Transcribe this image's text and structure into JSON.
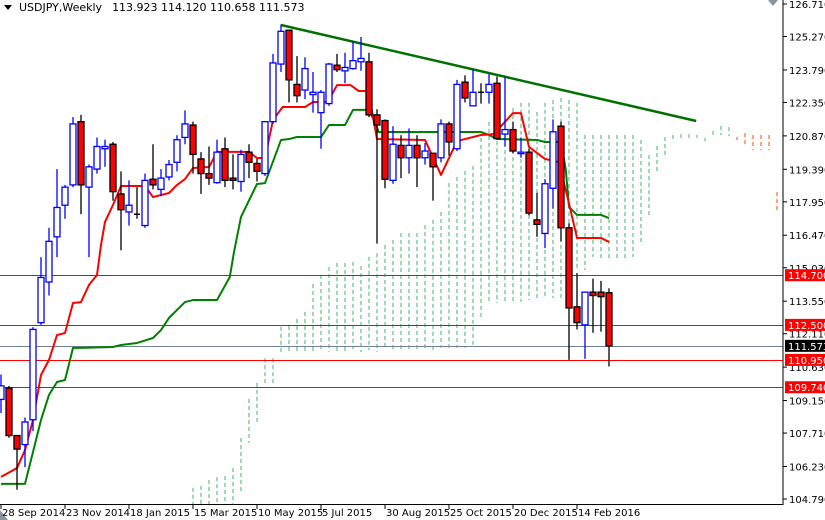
{
  "header": {
    "symbol": "USDJPY,Weekly",
    "ohlc": "113.923 114.120 110.658 111.573"
  },
  "colors": {
    "bull": "#0000ff",
    "bear": "#ff0000",
    "tenkan": "#ff0000",
    "kijun": "#008000",
    "trendline": "#007000",
    "cloud_bull": "#3cb371",
    "cloud_bear": "#ff4500",
    "level": "#ff0000",
    "current": "#708090"
  },
  "chart_data": {
    "type": "candlestick",
    "title": "USDJPY,Weekly",
    "ylim": [
      104.79,
      126.71
    ],
    "y_ticks": [
      "126.710",
      "125.270",
      "123.790",
      "122.350",
      "120.870",
      "119.390",
      "117.950",
      "116.470",
      "115.030",
      "113.550",
      "112.110",
      "110.630",
      "109.150",
      "107.710",
      "106.230",
      "104.790"
    ],
    "x_labels": [
      {
        "i": 0,
        "label": "28 Sep 2014"
      },
      {
        "i": 8,
        "label": "23 Nov 2014"
      },
      {
        "i": 16,
        "label": "18 Jan 2015"
      },
      {
        "i": 24,
        "label": "15 Mar 2015"
      },
      {
        "i": 32,
        "label": "10 May 2015"
      },
      {
        "i": 40,
        "label": "5 Jul 2015"
      },
      {
        "i": 48,
        "label": "30 Aug 2015"
      },
      {
        "i": 56,
        "label": "25 Oct 2015"
      },
      {
        "i": 64,
        "label": "20 Dec 2015"
      },
      {
        "i": 72,
        "label": "14 Feb 2016"
      }
    ],
    "candles_ohlc": [
      [
        109.2,
        110.3,
        108.6,
        109.8
      ],
      [
        109.7,
        109.8,
        107.5,
        107.6
      ],
      [
        107.6,
        107.6,
        105.2,
        107.0
      ],
      [
        107.2,
        108.4,
        106.2,
        108.2
      ],
      [
        108.3,
        112.4,
        107.8,
        112.3
      ],
      [
        112.6,
        115.5,
        112.5,
        114.6
      ],
      [
        114.4,
        116.8,
        113.8,
        116.2
      ],
      [
        116.4,
        119.4,
        115.5,
        117.7
      ],
      [
        117.8,
        118.7,
        117.2,
        118.6
      ],
      [
        118.7,
        121.7,
        118.6,
        121.4
      ],
      [
        121.5,
        121.8,
        117.4,
        118.7
      ],
      [
        118.6,
        119.6,
        115.5,
        119.5
      ],
      [
        119.4,
        120.8,
        119.2,
        120.4
      ],
      [
        120.3,
        120.7,
        119.5,
        120.4
      ],
      [
        120.5,
        120.6,
        118.0,
        118.4
      ],
      [
        118.3,
        119.3,
        115.8,
        117.6
      ],
      [
        117.5,
        118.9,
        116.9,
        117.8
      ],
      [
        117.4,
        118.6,
        117.2,
        117.4
      ],
      [
        116.9,
        119.2,
        116.8,
        118.9
      ],
      [
        118.95,
        120.5,
        118.5,
        118.7
      ],
      [
        118.5,
        119.4,
        118.2,
        119.0
      ],
      [
        119.05,
        119.8,
        118.9,
        119.6
      ],
      [
        119.7,
        120.9,
        119.3,
        120.7
      ],
      [
        120.8,
        122.0,
        120.5,
        121.4
      ],
      [
        121.35,
        121.5,
        119.2,
        120.05
      ],
      [
        119.85,
        120.15,
        118.3,
        119.2
      ],
      [
        119.2,
        120.4,
        118.7,
        119.0
      ],
      [
        118.8,
        120.7,
        118.75,
        120.15
      ],
      [
        120.3,
        120.8,
        118.6,
        118.9
      ],
      [
        119.0,
        120.05,
        118.5,
        118.9
      ],
      [
        118.85,
        120.25,
        118.4,
        120.05
      ],
      [
        120.15,
        120.5,
        119.0,
        119.7
      ],
      [
        119.65,
        119.85,
        118.85,
        119.3
      ],
      [
        119.2,
        121.5,
        119.1,
        121.5
      ],
      [
        121.5,
        124.5,
        121.4,
        124.1
      ],
      [
        124.05,
        125.8,
        123.7,
        125.5
      ],
      [
        125.55,
        125.55,
        122.35,
        123.35
      ],
      [
        123.15,
        124.4,
        122.35,
        122.65
      ],
      [
        122.9,
        124.35,
        122.5,
        123.85
      ],
      [
        122.7,
        123.7,
        121.9,
        122.8
      ],
      [
        121.9,
        122.9,
        120.3,
        122.8
      ],
      [
        122.3,
        124.1,
        122.2,
        124.05
      ],
      [
        124.0,
        124.5,
        123.7,
        123.8
      ],
      [
        123.75,
        124.55,
        123.2,
        123.9
      ],
      [
        123.85,
        125.05,
        123.8,
        124.2
      ],
      [
        124.15,
        125.25,
        123.75,
        124.3
      ],
      [
        124.15,
        124.55,
        121.7,
        121.8
      ],
      [
        121.8,
        122.05,
        116.1,
        121.35
      ],
      [
        121.55,
        121.6,
        118.55,
        118.95
      ],
      [
        118.9,
        121.3,
        118.75,
        120.5
      ],
      [
        120.45,
        120.9,
        119.0,
        119.9
      ],
      [
        119.9,
        121.2,
        119.2,
        120.45
      ],
      [
        120.45,
        120.9,
        118.6,
        119.9
      ],
      [
        119.9,
        120.55,
        119.6,
        120.2
      ],
      [
        120.1,
        120.1,
        118.0,
        119.5
      ],
      [
        119.9,
        121.6,
        119.7,
        121.4
      ],
      [
        121.4,
        121.5,
        120.0,
        120.6
      ],
      [
        120.3,
        123.35,
        120.2,
        123.15
      ],
      [
        123.25,
        123.55,
        122.35,
        122.55
      ],
      [
        122.2,
        123.8,
        122.2,
        122.8
      ],
      [
        122.8,
        123.2,
        122.3,
        122.8
      ],
      [
        122.8,
        123.6,
        122.3,
        123.15
      ],
      [
        123.2,
        123.5,
        120.7,
        120.75
      ],
      [
        120.95,
        123.5,
        120.4,
        121.15
      ],
      [
        121.15,
        121.5,
        120.1,
        120.2
      ],
      [
        120.1,
        120.8,
        119.9,
        120.15
      ],
      [
        120.15,
        120.3,
        117.35,
        117.45
      ],
      [
        117.15,
        118.35,
        116.4,
        116.95
      ],
      [
        116.55,
        118.95,
        115.9,
        118.75
      ],
      [
        118.55,
        121.6,
        117.65,
        121.05
      ],
      [
        121.3,
        121.5,
        116.2,
        116.8
      ],
      [
        116.8,
        117.0,
        110.95,
        113.25
      ],
      [
        113.3,
        114.8,
        112.3,
        112.6
      ],
      [
        112.5,
        113.95,
        111.0,
        113.95
      ],
      [
        113.95,
        114.55,
        112.15,
        113.8
      ],
      [
        113.95,
        114.45,
        112.2,
        113.75
      ],
      [
        113.923,
        114.12,
        110.658,
        111.573
      ]
    ],
    "tenkan": [
      [
        0,
        105.77
      ],
      [
        2,
        106.16
      ],
      [
        3,
        106.96
      ],
      [
        4,
        108.29
      ],
      [
        5,
        110.28
      ],
      [
        6,
        110.95
      ],
      [
        7,
        112.05
      ],
      [
        8,
        112.14
      ],
      [
        9,
        113.47
      ],
      [
        10,
        113.51
      ],
      [
        11,
        114.27
      ],
      [
        12,
        114.71
      ],
      [
        12.5,
        116.04
      ],
      [
        13,
        117.06
      ],
      [
        14,
        117.81
      ],
      [
        15,
        118.65
      ],
      [
        18,
        118.65
      ],
      [
        19,
        118.16
      ],
      [
        21,
        118.34
      ],
      [
        22,
        118.7
      ],
      [
        23,
        118.96
      ],
      [
        24,
        119.45
      ],
      [
        26,
        119.49
      ],
      [
        27,
        120.16
      ],
      [
        31,
        120.16
      ],
      [
        32,
        119.89
      ],
      [
        33,
        119.89
      ],
      [
        34,
        121.57
      ],
      [
        35.2,
        122.15
      ],
      [
        38,
        122.15
      ],
      [
        39,
        122.37
      ],
      [
        40.6,
        122.37
      ],
      [
        41.2,
        122.59
      ],
      [
        42,
        123.12
      ],
      [
        43.7,
        123.12
      ],
      [
        44.7,
        122.86
      ],
      [
        45.9,
        122.86
      ],
      [
        46.5,
        121.71
      ],
      [
        47,
        120.73
      ],
      [
        53,
        120.69
      ],
      [
        55,
        119.14
      ],
      [
        57,
        120.64
      ],
      [
        60,
        120.91
      ],
      [
        61.6,
        120.95
      ],
      [
        64,
        121.88
      ],
      [
        65,
        121.88
      ],
      [
        66,
        120.38
      ],
      [
        68,
        119.85
      ],
      [
        69.7,
        119.71
      ],
      [
        70.9,
        118.03
      ],
      [
        72,
        116.35
      ],
      [
        75,
        116.35
      ],
      [
        76,
        116.17
      ]
    ],
    "kijun": [
      [
        0,
        105.46
      ],
      [
        3,
        105.46
      ],
      [
        5,
        108.29
      ],
      [
        6,
        109.4
      ],
      [
        7,
        109.97
      ],
      [
        8,
        110.06
      ],
      [
        9,
        111.48
      ],
      [
        10,
        111.48
      ],
      [
        14,
        111.52
      ],
      [
        15,
        111.61
      ],
      [
        17,
        111.7
      ],
      [
        19,
        111.92
      ],
      [
        20,
        112.27
      ],
      [
        21,
        112.81
      ],
      [
        23,
        113.51
      ],
      [
        24,
        113.6
      ],
      [
        27,
        113.6
      ],
      [
        28.6,
        114.62
      ],
      [
        29.1,
        115.68
      ],
      [
        30,
        117.28
      ],
      [
        32,
        118.74
      ],
      [
        33,
        118.78
      ],
      [
        35,
        120.69
      ],
      [
        36,
        120.73
      ],
      [
        37,
        120.82
      ],
      [
        40,
        120.82
      ],
      [
        41,
        121.35
      ],
      [
        43,
        121.35
      ],
      [
        44,
        122.02
      ],
      [
        46,
        122.02
      ],
      [
        47,
        121.26
      ],
      [
        47.2,
        121.04
      ],
      [
        60,
        121.04
      ],
      [
        61,
        120.91
      ],
      [
        62,
        120.73
      ],
      [
        67,
        120.69
      ],
      [
        68,
        120.6
      ],
      [
        70,
        120.6
      ],
      [
        70.6,
        119.36
      ],
      [
        71,
        117.72
      ],
      [
        72,
        117.37
      ],
      [
        75,
        117.37
      ],
      [
        76,
        117.23
      ]
    ],
    "cloud_start_index": 24,
    "cloud_spanA_spanB": [
      [
        105.28,
        104.5
      ],
      [
        105.37,
        104.5
      ],
      [
        105.63,
        104.5
      ],
      [
        105.76,
        104.5
      ],
      [
        105.81,
        104.5
      ],
      [
        106.16,
        104.5
      ],
      [
        107.49,
        105.06
      ],
      [
        109.22,
        107.27
      ],
      [
        109.93,
        108.2
      ],
      [
        111.03,
        109.84
      ],
      [
        111.03,
        109.84
      ],
      [
        112.41,
        111.26
      ],
      [
        112.45,
        111.3
      ],
      [
        112.76,
        111.3
      ],
      [
        113.07,
        111.34
      ],
      [
        114.31,
        111.3
      ],
      [
        114.71,
        111.34
      ],
      [
        115.06,
        111.3
      ],
      [
        115.24,
        111.34
      ],
      [
        115.24,
        111.34
      ],
      [
        115.29,
        111.43
      ],
      [
        115.11,
        111.3
      ],
      [
        115.51,
        111.39
      ],
      [
        115.68,
        111.3
      ],
      [
        116.04,
        111.39
      ],
      [
        116.26,
        111.39
      ],
      [
        116.57,
        111.39
      ],
      [
        116.57,
        111.39
      ],
      [
        116.57,
        111.39
      ],
      [
        116.92,
        111.43
      ],
      [
        117.15,
        111.39
      ],
      [
        117.5,
        111.48
      ],
      [
        118.78,
        111.48
      ],
      [
        119.05,
        111.48
      ],
      [
        119.32,
        111.48
      ],
      [
        119.54,
        111.52
      ],
      [
        120.78,
        112.76
      ],
      [
        121.49,
        113.47
      ],
      [
        121.88,
        113.47
      ],
      [
        122.1,
        113.47
      ],
      [
        122.1,
        113.47
      ],
      [
        122.33,
        113.52
      ],
      [
        122.33,
        113.6
      ],
      [
        121.93,
        113.6
      ],
      [
        122.33,
        113.69
      ],
      [
        122.46,
        113.69
      ],
      [
        122.55,
        113.69
      ],
      [
        122.46,
        114.27
      ],
      [
        122.33,
        114.93
      ],
      [
        120.91,
        114.93
      ],
      [
        120.91,
        115.51
      ],
      [
        120.91,
        115.46
      ],
      [
        120.91,
        115.46
      ],
      [
        120.91,
        115.46
      ],
      [
        120.91,
        115.46
      ],
      [
        120.91,
        115.51
      ],
      [
        120.69,
        116.04
      ],
      [
        120.02,
        117.28
      ],
      [
        120.42,
        119.23
      ],
      [
        120.82,
        119.89
      ],
      [
        120.91,
        120.6
      ],
      [
        120.95,
        120.64
      ],
      [
        120.95,
        120.64
      ],
      [
        120.91,
        120.78
      ],
      [
        120.78,
        120.64
      ],
      [
        121.09,
        120.78
      ],
      [
        121.31,
        120.91
      ],
      [
        121.26,
        120.86
      ],
      [
        120.69,
        120.82
      ],
      [
        120.38,
        120.99
      ],
      [
        120.24,
        120.91
      ],
      [
        120.24,
        120.91
      ],
      [
        120.24,
        120.91
      ],
      [
        117.46,
        118.38
      ]
    ],
    "trendline": [
      [
        35,
        125.78
      ],
      [
        86.9,
        121.53
      ]
    ],
    "levels": [
      {
        "price": 114.7,
        "label": "114.700",
        "kind": "level"
      },
      {
        "price": 112.5,
        "label": "112.500",
        "kind": "level"
      },
      {
        "price": 110.95,
        "label": "110.950",
        "kind": "level"
      },
      {
        "price": 109.74,
        "label": "109.740",
        "kind": "level"
      },
      {
        "price": 111.573,
        "label": "111.573",
        "kind": "current"
      }
    ]
  }
}
